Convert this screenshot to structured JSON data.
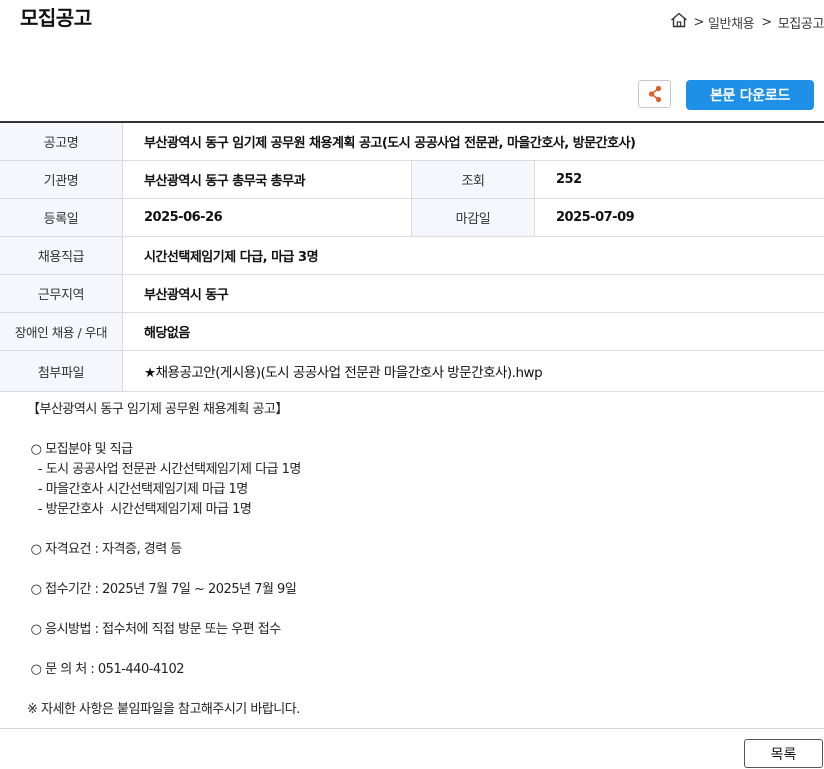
{
  "header": {
    "title": "모집공고",
    "breadcrumb": [
      ">",
      "일반채용",
      ">",
      "모집공고"
    ]
  },
  "toolbar": {
    "share_icon": "share-icon",
    "download_label": "본문 다운로드"
  },
  "info": {
    "title_label": "공고명",
    "title_value": "부산광역시 동구 임기제 공무원 채용계획 공고(도시 공공사업 전문관, 마을간호사, 방문간호사)",
    "org_label": "기관명",
    "org_value": "부산광역시 동구 총무국 총무과",
    "views_label": "조회",
    "views_value": "252",
    "reg_label": "등록일",
    "reg_value": "2025-06-26",
    "deadline_label": "마감일",
    "deadline_value": "2025-07-09",
    "grade_label": "채용직급",
    "grade_value": "시간선택제임기제 다급, 마급 3명",
    "region_label": "근무지역",
    "region_value": "부산광역시 동구",
    "disabled_label": "장애인 채용 / 우대",
    "disabled_value": "해당없음",
    "attach_label": "첨부파일",
    "attach_value": "★채용공고안(게시용)(도시 공공사업 전문관 마을간호사 방문간호사).hwp"
  },
  "body": {
    "lines": [
      "【부산광역시 동구 임기제 공무원 채용계획 공고】",
      "",
      " ○ 모집분야 및 직급",
      "   - 도시 공공사업 전문관 시간선택제임기제 다급 1명",
      "   - 마을간호사 시간선택제임기제 마급 1명",
      "   - 방문간호사  시간선택제임기제 마급 1명",
      "",
      " ○ 자격요건 : 자격증, 경력 등",
      "",
      " ○ 접수기간 : 2025년 7월 7일 ~ 2025년 7월 9일",
      "",
      " ○ 응시방법 : 접수처에 직접 방문 또는 우편 접수",
      "",
      " ○ 문 의 처 : 051-440-4102",
      "",
      "※ 자세한 사항은 붙임파일을 참고해주시기 바랍니다."
    ]
  },
  "footer": {
    "list_label": "목록"
  }
}
